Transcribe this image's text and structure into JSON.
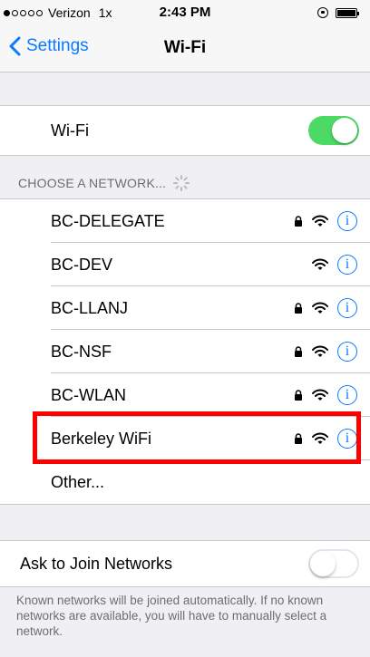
{
  "status_bar": {
    "carrier": "Verizon",
    "network": "1x",
    "time": "2:43 PM"
  },
  "nav": {
    "back_label": "Settings",
    "title": "Wi-Fi"
  },
  "wifi_toggle": {
    "label": "Wi-Fi",
    "on": true
  },
  "section_header": "CHOOSE A NETWORK...",
  "networks": [
    {
      "name": "BC-DELEGATE",
      "locked": true
    },
    {
      "name": "BC-DEV",
      "locked": false
    },
    {
      "name": "BC-LLANJ",
      "locked": true
    },
    {
      "name": "BC-NSF",
      "locked": true
    },
    {
      "name": "BC-WLAN",
      "locked": true
    },
    {
      "name": "Berkeley WiFi",
      "locked": true,
      "highlighted": true
    }
  ],
  "other_label": "Other...",
  "ask_to_join": {
    "label": "Ask to Join Networks",
    "on": false
  },
  "footer": "Known networks will be joined automatically. If no known networks are available, you will have to manually select a network.",
  "colors": {
    "accent": "#0a7aff",
    "toggle_on": "#4cd964",
    "highlight": "#ff0000"
  }
}
